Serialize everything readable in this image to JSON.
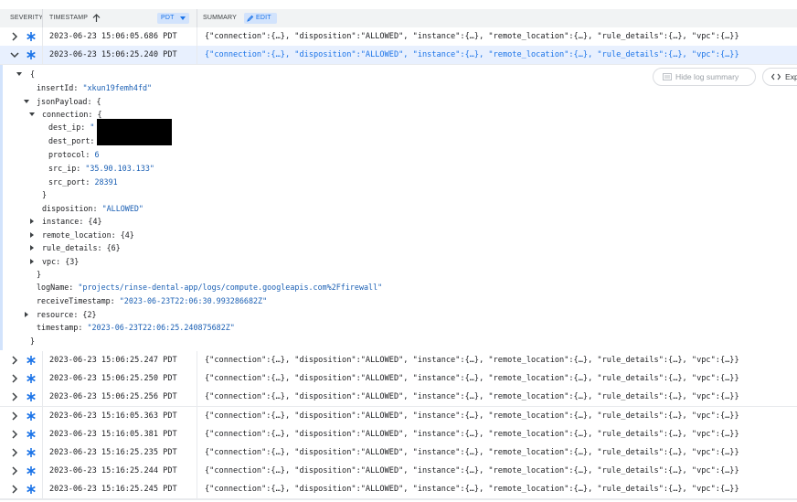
{
  "header": {
    "severity": "SEVERITY",
    "timestamp": "TIMESTAMP",
    "timezone": "PDT",
    "summary": "SUMMARY",
    "edit": "EDIT"
  },
  "rows_before": [
    {
      "timestamp": "2023-06-23 15:06:05.686 PDT",
      "summary": "{\"connection\":{…}, \"disposition\":\"ALLOWED\", \"instance\":{…}, \"remote_location\":{…}, \"rule_details\":{…}, \"vpc\":{…}}",
      "severity": "info-icon"
    }
  ],
  "expanded_row": {
    "timestamp": "2023-06-23 15:06:25.240 PDT",
    "summary": "{\"connection\":{…}, \"disposition\":\"ALLOWED\", \"instance\":{…}, \"remote_location\":{…}, \"rule_details\":{…}, \"vpc\":{…}}",
    "severity": "info-icon"
  },
  "detail": {
    "hide_summary_label": "Hide log summary",
    "expand_label": "Exp",
    "open_brace": "{",
    "insertId_key": "insertId:",
    "insertId_val": "\"xkun19femh4fd\"",
    "jsonPayload_key": "jsonPayload: {",
    "connection_key": "connection: {",
    "dest_ip_key": "dest_ip:",
    "dest_ip_val": "\"",
    "dest_port_key": "dest_port:",
    "protocol_key": "protocol:",
    "protocol_val": "6",
    "src_ip_key": "src_ip:",
    "src_ip_val": "\"35.90.103.133\"",
    "src_port_key": "src_port:",
    "src_port_val": "28391",
    "close_connection": "}",
    "disposition_key": "disposition:",
    "disposition_val": "\"ALLOWED\"",
    "instance_key": "instance: {4}",
    "remote_location_key": "remote_location: {4}",
    "rule_details_key": "rule_details: {6}",
    "vpc_key": "vpc: {3}",
    "close_payload": "}",
    "logName_key": "logName:",
    "logName_val": "\"projects/rinse-dental-app/logs/compute.googleapis.com%2Ffirewall\"",
    "receiveTimestamp_key": "receiveTimestamp:",
    "receiveTimestamp_val": "\"2023-06-23T22:06:30.993286682Z\"",
    "resource_key": "resource: {2}",
    "timestamp_key": "timestamp:",
    "timestamp_val": "\"2023-06-23T22:06:25.240875682Z\"",
    "close_brace": "}"
  },
  "rows_after": [
    {
      "timestamp": "2023-06-23 15:06:25.247 PDT",
      "summary": "{\"connection\":{…}, \"disposition\":\"ALLOWED\", \"instance\":{…}, \"remote_location\":{…}, \"rule_details\":{…}, \"vpc\":{…}}"
    },
    {
      "timestamp": "2023-06-23 15:06:25.250 PDT",
      "summary": "{\"connection\":{…}, \"disposition\":\"ALLOWED\", \"instance\":{…}, \"remote_location\":{…}, \"rule_details\":{…}, \"vpc\":{…}}"
    },
    {
      "timestamp": "2023-06-23 15:06:25.256 PDT",
      "summary": "{\"connection\":{…}, \"disposition\":\"ALLOWED\", \"instance\":{…}, \"remote_location\":{…}, \"rule_details\":{…}, \"vpc\":{…}}"
    },
    {
      "timestamp": "2023-06-23 15:16:05.363 PDT",
      "summary": "{\"connection\":{…}, \"disposition\":\"ALLOWED\", \"instance\":{…}, \"remote_location\":{…}, \"rule_details\":{…}, \"vpc\":{…}}"
    },
    {
      "timestamp": "2023-06-23 15:16:05.381 PDT",
      "summary": "{\"connection\":{…}, \"disposition\":\"ALLOWED\", \"instance\":{…}, \"remote_location\":{…}, \"rule_details\":{…}, \"vpc\":{…}}"
    },
    {
      "timestamp": "2023-06-23 15:16:25.235 PDT",
      "summary": "{\"connection\":{…}, \"disposition\":\"ALLOWED\", \"instance\":{…}, \"remote_location\":{…}, \"rule_details\":{…}, \"vpc\":{…}}"
    },
    {
      "timestamp": "2023-06-23 15:16:25.244 PDT",
      "summary": "{\"connection\":{…}, \"disposition\":\"ALLOWED\", \"instance\":{…}, \"remote_location\":{…}, \"rule_details\":{…}, \"vpc\":{…}}"
    },
    {
      "timestamp": "2023-06-23 15:16:25.245 PDT",
      "summary": "{\"connection\":{…}, \"disposition\":\"ALLOWED\", \"instance\":{…}, \"remote_location\":{…}, \"rule_details\":{…}, \"vpc\":{…}}"
    }
  ],
  "colors": {
    "accent": "#1a73e8",
    "severity_info": "#1a73e8",
    "json_string": "#1a5fb4"
  }
}
